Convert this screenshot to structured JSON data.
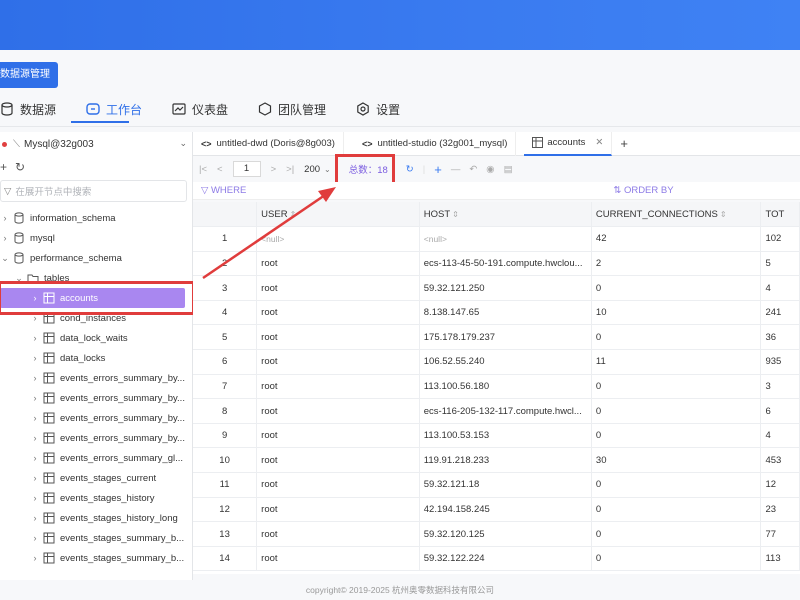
{
  "header": {
    "data_source_btn": "数据源管理"
  },
  "nav": [
    {
      "label": "数据源",
      "icon": "database-icon"
    },
    {
      "label": "工作台",
      "icon": "workbench-icon",
      "active": true
    },
    {
      "label": "仪表盘",
      "icon": "dashboard-icon"
    },
    {
      "label": "团队管理",
      "icon": "team-icon"
    },
    {
      "label": "设置",
      "icon": "gear-icon"
    }
  ],
  "sidebar": {
    "connection": "Mysql@32g003",
    "search_placeholder": "在展开节点中搜索",
    "tree": [
      {
        "label": "information_schema",
        "level": 0
      },
      {
        "label": "mysql",
        "level": 0
      },
      {
        "label": "performance_schema",
        "level": 0
      },
      {
        "label": "tables",
        "level": 1
      },
      {
        "label": "accounts",
        "level": 2,
        "selected": true
      },
      {
        "label": "cond_instances",
        "level": 2
      },
      {
        "label": "data_lock_waits",
        "level": 2
      },
      {
        "label": "data_locks",
        "level": 2
      },
      {
        "label": "events_errors_summary_by...",
        "level": 2
      },
      {
        "label": "events_errors_summary_by...",
        "level": 2
      },
      {
        "label": "events_errors_summary_by...",
        "level": 2
      },
      {
        "label": "events_errors_summary_by...",
        "level": 2
      },
      {
        "label": "events_errors_summary_gl...",
        "level": 2
      },
      {
        "label": "events_stages_current",
        "level": 2
      },
      {
        "label": "events_stages_history",
        "level": 2
      },
      {
        "label": "events_stages_history_long",
        "level": 2
      },
      {
        "label": "events_stages_summary_b...",
        "level": 2
      },
      {
        "label": "events_stages_summary_b...",
        "level": 2
      }
    ]
  },
  "tabs": [
    {
      "label": "untitled-dwd (Doris@8g003)",
      "icon": "<>"
    },
    {
      "label": "untitled-studio (32g001_mysql)",
      "icon": "<>"
    },
    {
      "label": "accounts",
      "icon": "table",
      "active": true
    }
  ],
  "toolbar": {
    "page": "1",
    "page_size": "200",
    "total": "总数：18"
  },
  "filter": {
    "where": "WHERE",
    "order": "ORDER BY"
  },
  "table": {
    "columns": [
      "USER",
      "HOST",
      "CURRENT_CONNECTIONS",
      "TOT"
    ],
    "rows": [
      [
        "1",
        "<null>",
        "<null>",
        "42",
        "102"
      ],
      [
        "2",
        "root",
        "ecs-113-45-50-191.compute.hwclou...",
        "2",
        "5"
      ],
      [
        "3",
        "root",
        "59.32.121.250",
        "0",
        "4"
      ],
      [
        "4",
        "root",
        "8.138.147.65",
        "10",
        "241"
      ],
      [
        "5",
        "root",
        "175.178.179.237",
        "0",
        "36"
      ],
      [
        "6",
        "root",
        "106.52.55.240",
        "11",
        "935"
      ],
      [
        "7",
        "root",
        "113.100.56.180",
        "0",
        "3"
      ],
      [
        "8",
        "root",
        "ecs-116-205-132-117.compute.hwcl...",
        "0",
        "6"
      ],
      [
        "9",
        "root",
        "113.100.53.153",
        "0",
        "4"
      ],
      [
        "10",
        "root",
        "119.91.218.233",
        "30",
        "453"
      ],
      [
        "11",
        "root",
        "59.32.121.18",
        "0",
        "12"
      ],
      [
        "12",
        "root",
        "42.194.158.245",
        "0",
        "23"
      ],
      [
        "13",
        "root",
        "59.32.120.125",
        "0",
        "77"
      ],
      [
        "14",
        "root",
        "59.32.122.224",
        "0",
        "113"
      ]
    ]
  },
  "footer": "copyright© 2019-2025 杭州奥零数据科技有限公司",
  "colors": {
    "accent": "#2f6fe8",
    "highlight": "#e03c3c",
    "selected": "#a987f0"
  }
}
